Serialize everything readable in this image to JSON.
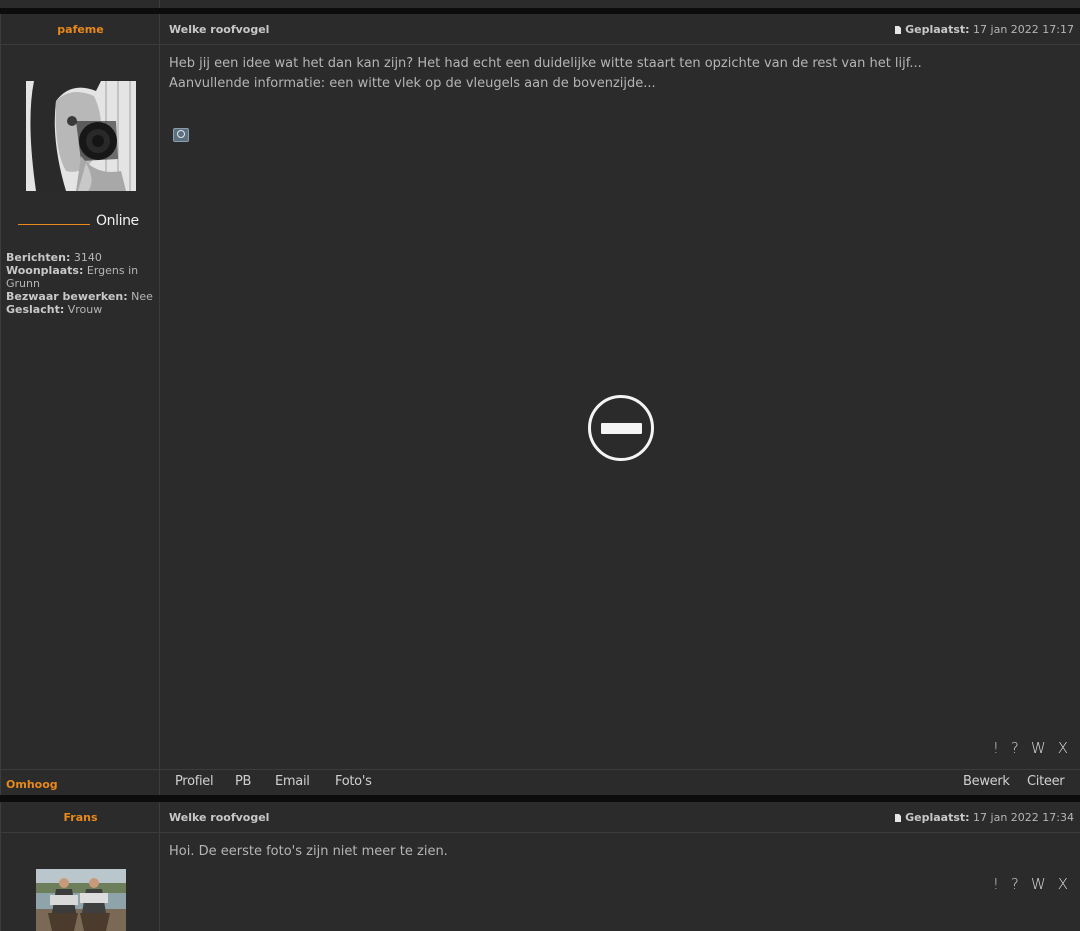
{
  "posts": [
    {
      "author": "pafeme",
      "subject": "Welke roofvogel",
      "posted_label": "Geplaatst:",
      "posted_date": "17 jan 2022 17:17",
      "body_line1": "Heb jij een idee wat het dan kan zijn? Het had echt een duidelijke witte staart ten opzichte van de rest van het lijf...",
      "body_line2": "Aanvullende informatie: een witte vlek op de vleugels aan de bovenzijde...",
      "online_label": "Online",
      "stats": {
        "berichten_label": "Berichten:",
        "berichten": "3140",
        "woonplaats_label": "Woonplaats:",
        "woonplaats_a": "Ergens in",
        "woonplaats_b": "Grunn",
        "bezwaar_label": "Bezwaar bewerken:",
        "bezwaar": "Nee",
        "geslacht_label": "Geslacht:",
        "geslacht": "Vrouw"
      },
      "actions": [
        "!",
        "?",
        "W",
        "X"
      ],
      "footer": {
        "omhoog": "Omhoog",
        "profiel": "Profiel",
        "pb": "PB",
        "email": "Email",
        "fotos": "Foto's",
        "bewerk": "Bewerk",
        "citeer": "Citeer"
      }
    },
    {
      "author": "Frans",
      "subject": "Welke roofvogel",
      "posted_label": "Geplaatst:",
      "posted_date": "17 jan 2022 17:34",
      "body_line1": "Hoi. De eerste foto's zijn niet meer te zien.",
      "actions": [
        "!",
        "?",
        "W",
        "X"
      ]
    }
  ],
  "colors": {
    "accent": "#e8891a",
    "background": "#2b2b2b",
    "separator": "#0c0c0c"
  }
}
